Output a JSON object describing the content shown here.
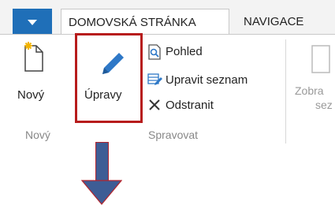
{
  "tabs": {
    "home": "DOMOVSKÁ STRÁNKA",
    "navigation": "NAVIGACE"
  },
  "ribbon": {
    "new_label": "Nový",
    "edit_label": "Úpravy",
    "view_label": "Pohled",
    "edit_list_label": "Upravit seznam",
    "delete_label": "Odstranit",
    "show_partial_1": "Zobra",
    "show_partial_2": "sez",
    "group_new": "Nový",
    "group_manage": "Spravovat"
  },
  "colors": {
    "menu_button": "#1f6fb8",
    "highlight_border": "#b71c1c",
    "arrow_fill": "#3e5d95",
    "arrow_border": "#b3242d"
  },
  "icons": {
    "menu": "chevron-down-icon",
    "new": "new-document-icon",
    "edit": "pencil-icon",
    "view": "view-icon",
    "edit_list": "edit-list-icon",
    "delete": "delete-icon",
    "show": "show-icon"
  }
}
